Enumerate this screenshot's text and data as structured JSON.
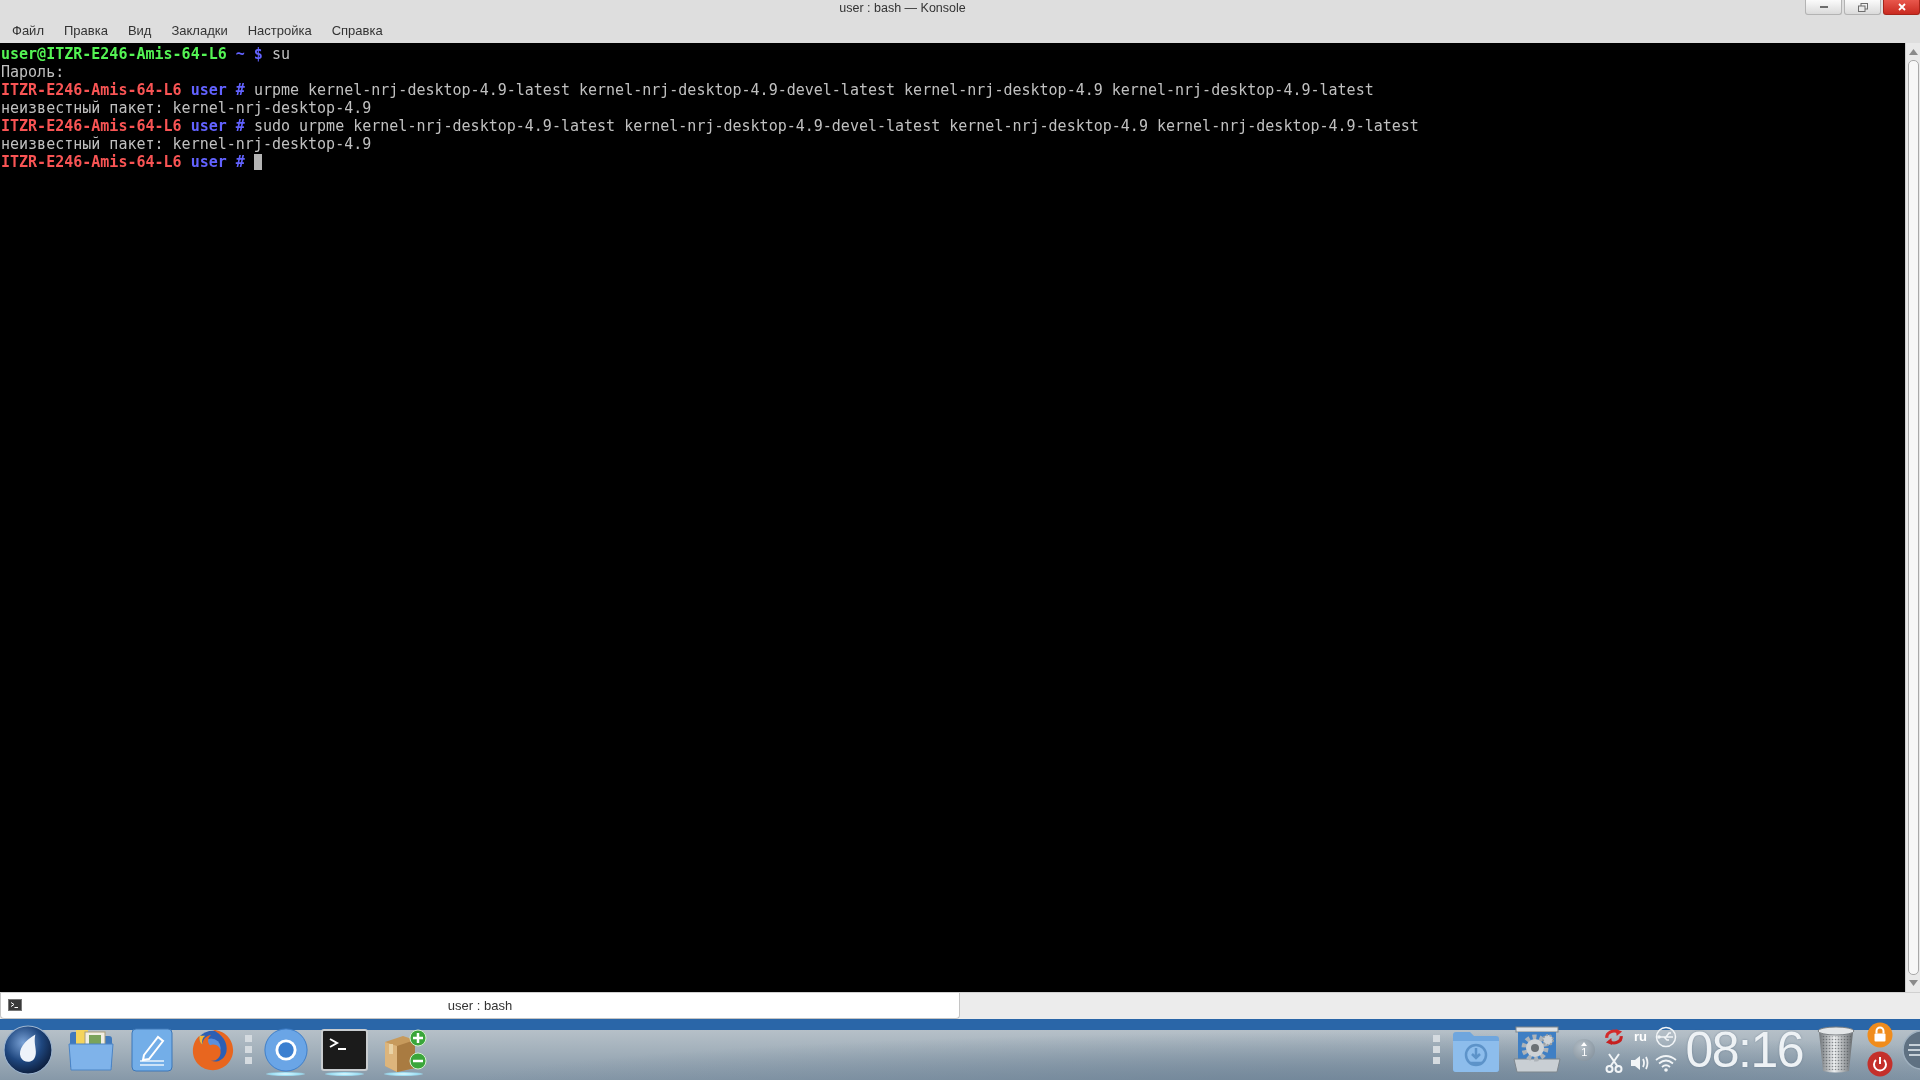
{
  "window": {
    "title": "user : bash — Konsole"
  },
  "menu": [
    "Файл",
    "Правка",
    "Вид",
    "Закладки",
    "Настройка",
    "Справка"
  ],
  "terminal": {
    "lines": [
      {
        "segments": [
          {
            "kind": "user",
            "text": "user@ITZR-E246-Amis-64-L6"
          },
          {
            "kind": "prompt",
            "text": "~ $"
          },
          {
            "kind": "plain",
            "text": "su"
          }
        ]
      },
      {
        "segments": [
          {
            "kind": "plain",
            "text": "Пароль:"
          }
        ]
      },
      {
        "segments": [
          {
            "kind": "root",
            "text": "ITZR-E246-Amis-64-L6"
          },
          {
            "kind": "prompt",
            "text": "user #"
          },
          {
            "kind": "plain",
            "text": "urpme kernel-nrj-desktop-4.9-latest kernel-nrj-desktop-4.9-devel-latest kernel-nrj-desktop-4.9 kernel-nrj-desktop-4.9-latest"
          }
        ]
      },
      {
        "segments": [
          {
            "kind": "plain",
            "text": "неизвестный пакет: kernel-nrj-desktop-4.9"
          }
        ]
      },
      {
        "segments": [
          {
            "kind": "root",
            "text": "ITZR-E246-Amis-64-L6"
          },
          {
            "kind": "prompt",
            "text": "user #"
          },
          {
            "kind": "plain",
            "text": "sudo urpme kernel-nrj-desktop-4.9-latest kernel-nrj-desktop-4.9-devel-latest kernel-nrj-desktop-4.9 kernel-nrj-desktop-4.9-latest"
          }
        ]
      },
      {
        "segments": [
          {
            "kind": "plain",
            "text": "неизвестный пакет: kernel-nrj-desktop-4.9"
          }
        ]
      },
      {
        "segments": [
          {
            "kind": "root",
            "text": "ITZR-E246-Amis-64-L6"
          },
          {
            "kind": "prompt",
            "text": "user #"
          }
        ]
      }
    ],
    "cursor": true
  },
  "tabs": [
    {
      "label": "user : bash",
      "selected": true
    }
  ],
  "taskbar": {
    "tasks": [
      {
        "kind": "web",
        "running": true
      },
      {
        "kind": "terminal",
        "running": true
      },
      {
        "kind": "packages",
        "running": true
      }
    ],
    "notifications": "1",
    "keyboard_layout": "ru",
    "clock": "08:16"
  }
}
